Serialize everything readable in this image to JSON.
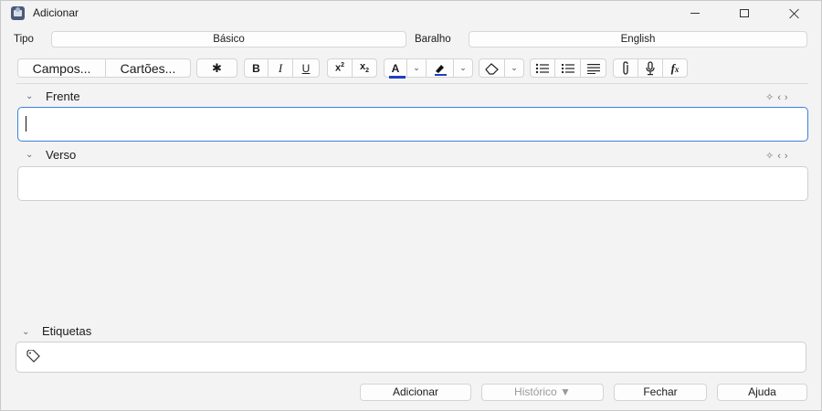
{
  "window": {
    "title": "Adicionar",
    "controls": {
      "minimize": "—",
      "maximize": "☐",
      "close": "✕"
    }
  },
  "type_row": {
    "type_label": "Tipo",
    "type_value": "Básico",
    "deck_label": "Baralho",
    "deck_value": "English"
  },
  "toolbar": {
    "fields_label": "Campos...",
    "cards_label": "Cartões...",
    "bold": "B",
    "italic": "I",
    "underline": "U",
    "text_color": "#1f3fbf",
    "highlight_color": "#1f3fbf"
  },
  "fields": [
    {
      "label": "Frente",
      "value": ""
    },
    {
      "label": "Verso",
      "value": ""
    }
  ],
  "tags": {
    "label": "Etiquetas",
    "value": ""
  },
  "bottom": {
    "add": "Adicionar",
    "history": "Histórico ▼",
    "close": "Fechar",
    "help": "Ajuda"
  },
  "colors": {
    "focus": "#3b82d8",
    "background": "#f3f3f3"
  }
}
